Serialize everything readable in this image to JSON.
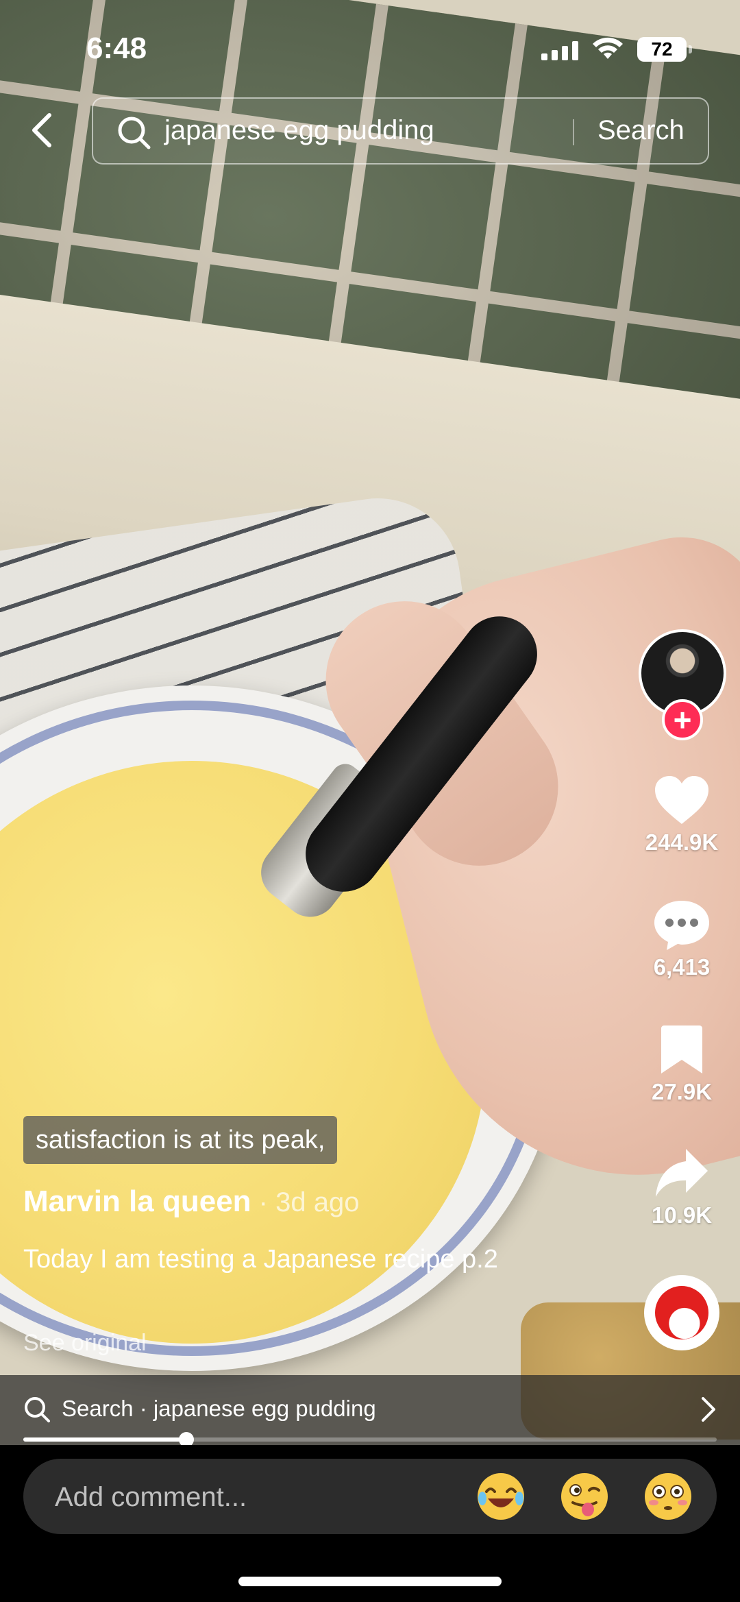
{
  "status_bar": {
    "time": "6:48",
    "battery": "72"
  },
  "search": {
    "query": "japanese egg pudding",
    "action_label": "Search"
  },
  "actions": {
    "likes": "244.9K",
    "comments": "6,413",
    "saves": "27.9K",
    "shares": "10.9K"
  },
  "caption": {
    "effect_text": "satisfaction is at its peak,",
    "author": "Marvin la queen",
    "time": " · 3d ago",
    "description": "Today I am testing a Japanese recipe p.2",
    "see_original": "See original"
  },
  "related_search": {
    "text": "Search · japanese egg pudding"
  },
  "playback": {
    "progress": 0.235
  },
  "comment_bar": {
    "placeholder": "Add comment..."
  },
  "emojis": [
    "face-with-tears-of-joy",
    "winking-face-with-tongue",
    "flushed-face"
  ],
  "colors": {
    "follow_accent": "#fe2c55",
    "sound_disc": "#e2201f"
  }
}
